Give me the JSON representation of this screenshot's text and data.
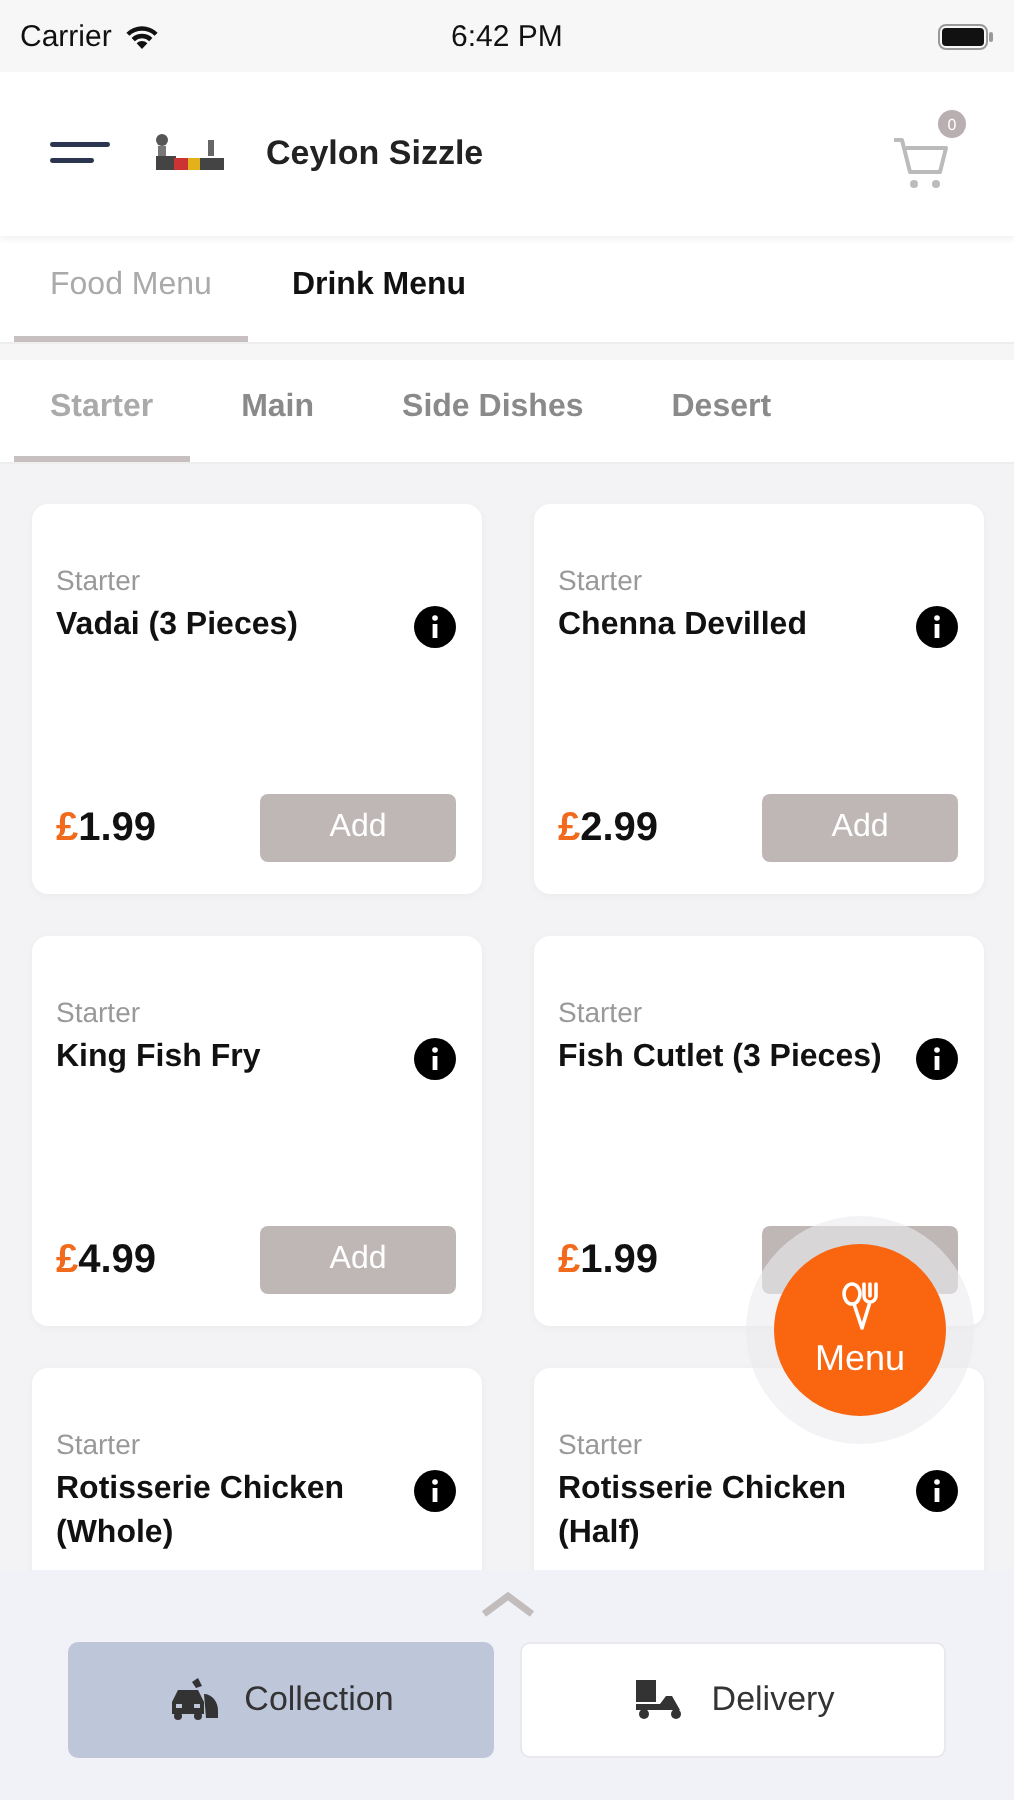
{
  "status_bar": {
    "carrier": "Carrier",
    "time": "6:42 PM"
  },
  "header": {
    "title": "Ceylon Sizzle",
    "cart_count": "0"
  },
  "menu_tabs": [
    {
      "label": "Food Menu",
      "selected": true
    },
    {
      "label": "Drink Menu",
      "selected": false
    }
  ],
  "category_tabs": [
    {
      "label": "Starter",
      "selected": true
    },
    {
      "label": "Main",
      "selected": false
    },
    {
      "label": "Side Dishes",
      "selected": false
    },
    {
      "label": "Desert",
      "selected": false
    }
  ],
  "items": [
    {
      "category": "Starter",
      "name": "Vadai (3 Pieces)",
      "currency": "£",
      "price": "1.99",
      "button": "Add"
    },
    {
      "category": "Starter",
      "name": "Chenna Devilled",
      "currency": "£",
      "price": "2.99",
      "button": "Add"
    },
    {
      "category": "Starter",
      "name": "King Fish Fry",
      "currency": "£",
      "price": "4.99",
      "button": "Add"
    },
    {
      "category": "Starter",
      "name": "Fish Cutlet (3 Pieces)",
      "currency": "£",
      "price": "1.99"
    },
    {
      "category": "Starter",
      "name": "Rotisserie Chicken (Whole)"
    },
    {
      "category": "Starter",
      "name": "Rotisserie Chicken (Half)"
    }
  ],
  "menu_button": {
    "label": "Menu"
  },
  "order_types": [
    {
      "label": "Collection",
      "kind": "collection",
      "selected": true
    },
    {
      "label": "Delivery",
      "kind": "delivery",
      "selected": false
    }
  ]
}
